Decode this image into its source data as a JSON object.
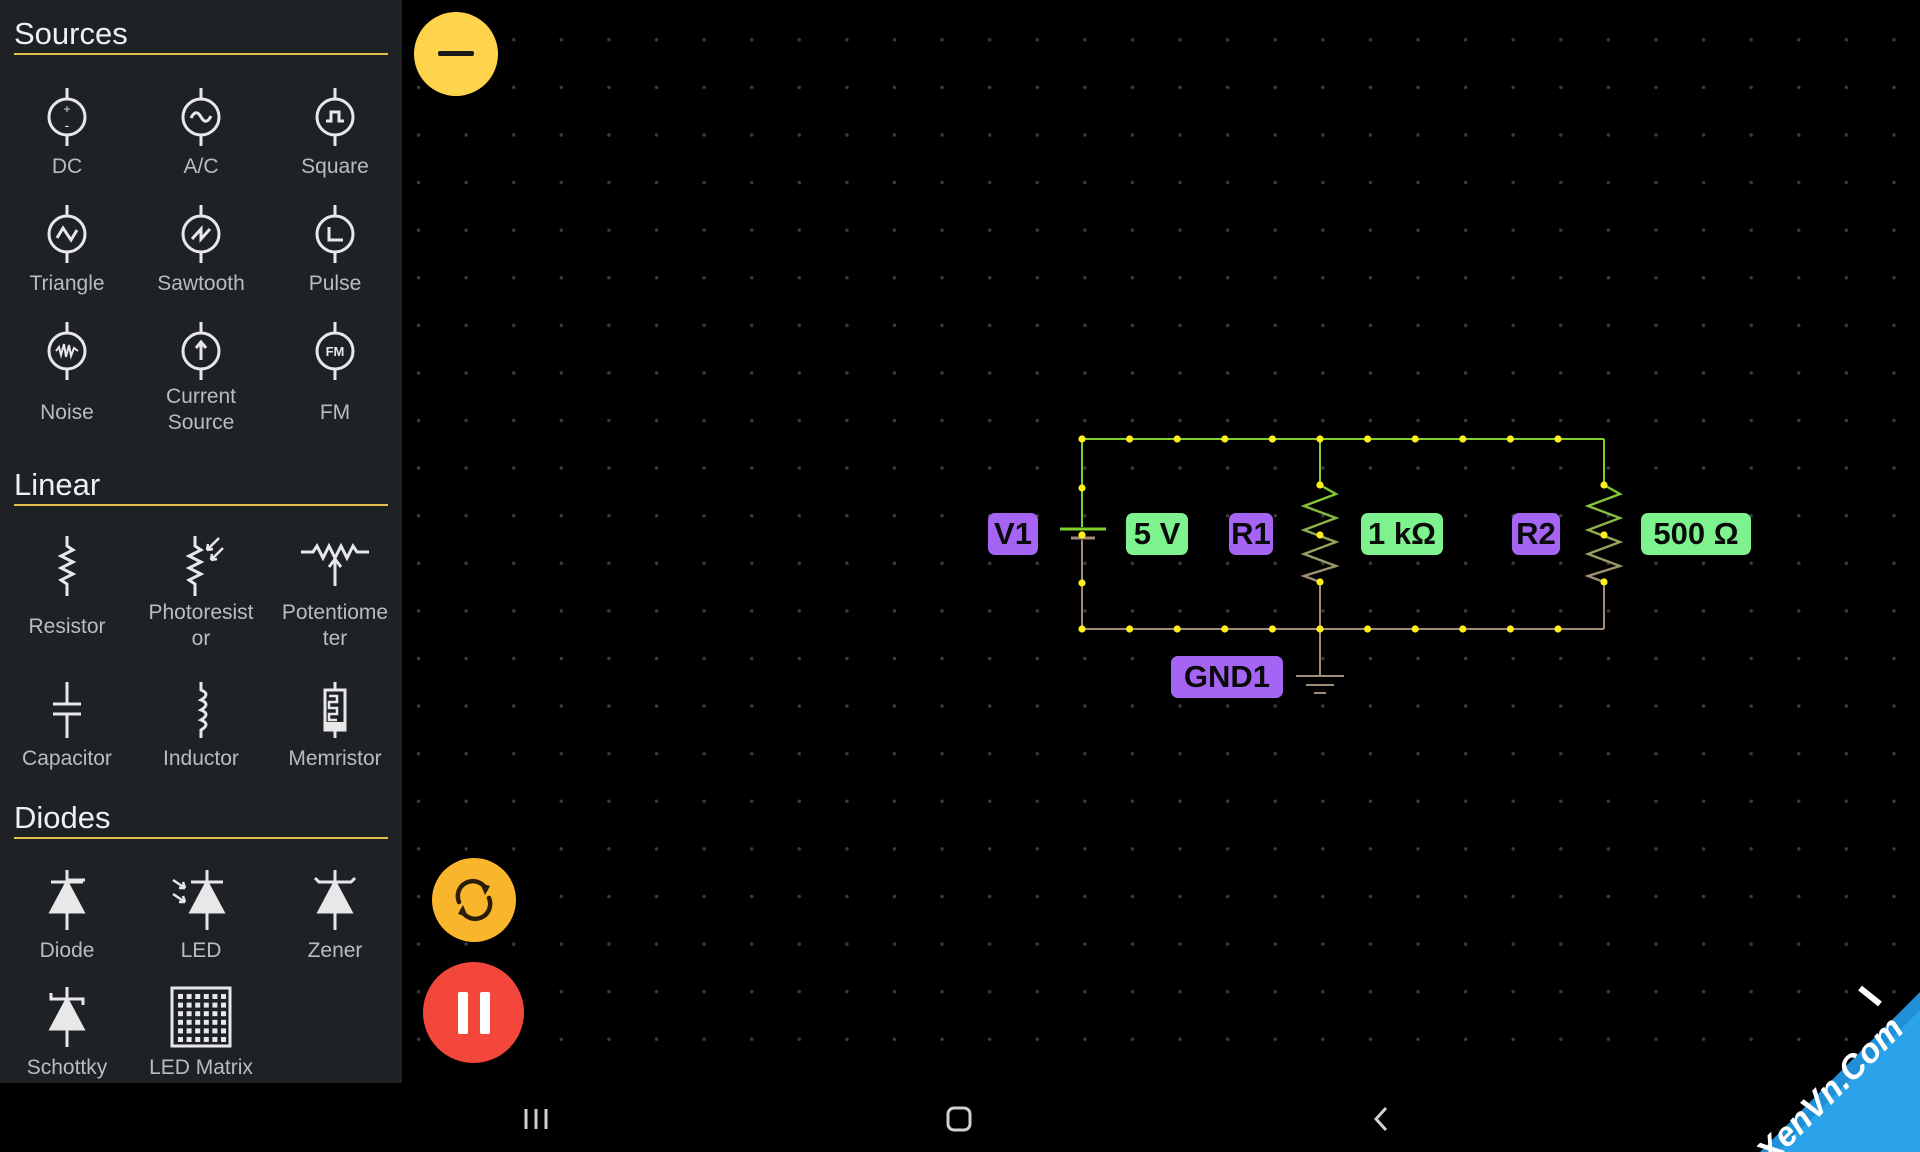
{
  "palette": {
    "title": "Sources",
    "sections": [
      {
        "title": "Sources",
        "items": [
          {
            "label": "DC",
            "icon": "dc-source-icon"
          },
          {
            "label": "A/C",
            "icon": "ac-source-icon"
          },
          {
            "label": "Square",
            "icon": "square-source-icon"
          },
          {
            "label": "Triangle",
            "icon": "triangle-source-icon"
          },
          {
            "label": "Sawtooth",
            "icon": "sawtooth-source-icon"
          },
          {
            "label": "Pulse",
            "icon": "pulse-source-icon"
          },
          {
            "label": "Noise",
            "icon": "noise-source-icon"
          },
          {
            "label": "Current Source",
            "icon": "current-source-icon"
          },
          {
            "label": "FM",
            "icon": "fm-source-icon"
          }
        ]
      },
      {
        "title": "Linear",
        "items": [
          {
            "label": "Resistor",
            "icon": "resistor-icon"
          },
          {
            "label": "Photoresistor",
            "icon": "photoresistor-icon"
          },
          {
            "label": "Potentiometer",
            "icon": "potentiometer-icon"
          },
          {
            "label": "Capacitor",
            "icon": "capacitor-icon"
          },
          {
            "label": "Inductor",
            "icon": "inductor-icon"
          },
          {
            "label": "Memristor",
            "icon": "memristor-icon"
          }
        ]
      },
      {
        "title": "Diodes",
        "items": [
          {
            "label": "Diode",
            "icon": "diode-icon"
          },
          {
            "label": "LED",
            "icon": "led-icon"
          },
          {
            "label": "Zener",
            "icon": "zener-icon"
          },
          {
            "label": "Schottky",
            "icon": "schottky-icon"
          },
          {
            "label": "LED Matrix",
            "icon": "led-matrix-icon"
          }
        ]
      }
    ]
  },
  "labels_split": {
    "current_source": [
      "Current",
      "Source"
    ],
    "photoresistor": [
      "Photoresist",
      "or"
    ],
    "potentiometer": [
      "Potentiome",
      "ter"
    ]
  },
  "circuit": {
    "components": [
      {
        "id": "V1",
        "value": "5 V"
      },
      {
        "id": "R1",
        "value": "1 kΩ"
      },
      {
        "id": "R2",
        "value": "500 Ω"
      },
      {
        "id": "GND1",
        "value": ""
      }
    ]
  },
  "buttons": {
    "collapse_icon": "minus-icon",
    "reset_icon": "refresh-icon",
    "pause_icon": "pause-icon"
  },
  "navbar": {
    "recent_icon": "recent-apps-icon",
    "home_icon": "home-icon",
    "back_icon": "back-icon"
  },
  "watermark": {
    "text": "XenVn.Com"
  },
  "colors": {
    "sidebar_bg": "#1e2226",
    "section_underline": "#e3c14a",
    "wire_high": "#7fd02a",
    "wire_low": "#a08a78",
    "node": "#ffef1a",
    "id_tag": "#a664f4",
    "value_tag": "#7ef28e",
    "fab_yellow": "#ffd44d",
    "fab_orange": "#f9b52b",
    "fab_red": "#f2473a"
  }
}
